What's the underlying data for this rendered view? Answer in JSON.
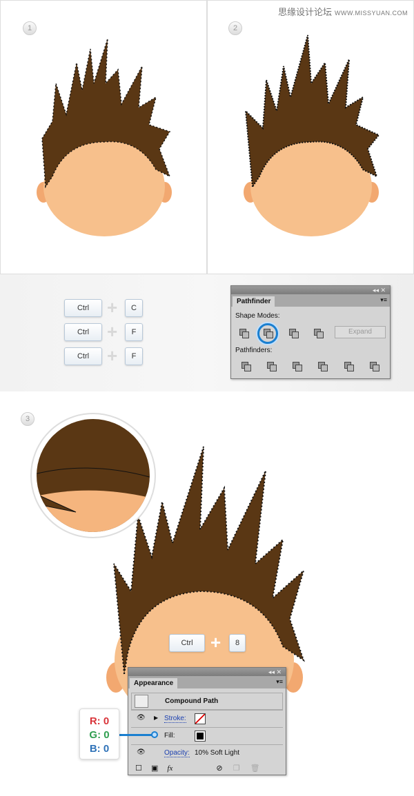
{
  "watermark": {
    "site_name": "思缘设计论坛",
    "url": "WWW.MISSYUAN.COM"
  },
  "steps": [
    "1",
    "2",
    "3"
  ],
  "shortcuts": [
    {
      "modifier": "Ctrl",
      "key": "C"
    },
    {
      "modifier": "Ctrl",
      "key": "F"
    },
    {
      "modifier": "Ctrl",
      "key": "F"
    }
  ],
  "shortcut_step3": {
    "modifier": "Ctrl",
    "key": "8"
  },
  "pathfinder": {
    "tab": "Pathfinder",
    "shape_modes_label": "Shape Modes:",
    "expand_label": "Expand",
    "pathfinders_label": "Pathfinders:",
    "selected_shape_mode": "minus-front",
    "controls": "◂◂ ✕"
  },
  "appearance": {
    "tab": "Appearance",
    "title": "Compound Path",
    "stroke_label": "Stroke:",
    "fill_label": "Fill:",
    "opacity_label": "Opacity:",
    "opacity_value": "10% Soft Light",
    "fx_label": "fx",
    "controls": "◂◂ ✕"
  },
  "rgb": {
    "r": "R: 0",
    "g": "G: 0",
    "b": "B: 0",
    "r_color": "#d9343a",
    "g_color": "#2f9e4f",
    "b_color": "#2f72b8"
  },
  "colors": {
    "hair": "#5a3714",
    "skin": "#f7c08c",
    "accent": "#1a7fd0"
  }
}
